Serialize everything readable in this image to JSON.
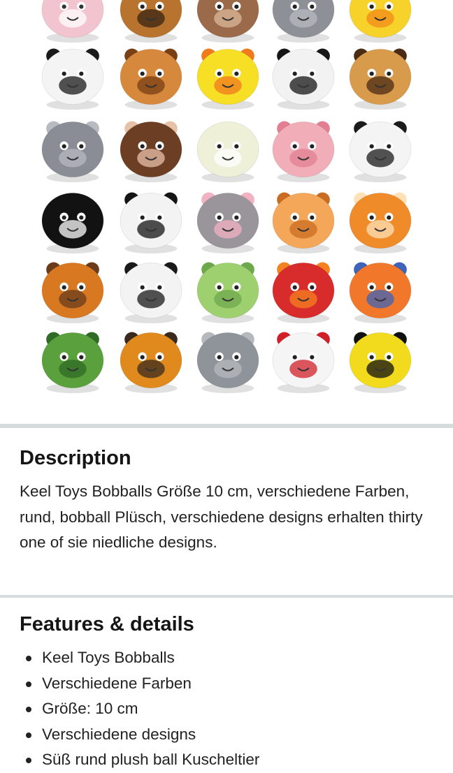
{
  "description": {
    "heading": "Description",
    "text": "Keel Toys Bobballs Größe 10 cm, verschiedene Farben, rund, bobball Plüsch, verschiedene designs erhalten thirty one of sie niedliche designs."
  },
  "features": {
    "heading": "Features & details",
    "items": [
      "Keel Toys Bobballs",
      "Verschiedene Farben",
      "Größe: 10 cm",
      "Verschiedene designs",
      "Süß rund plush ball Kuscheltier"
    ]
  },
  "gallery": {
    "plushies": [
      {
        "name": "pink-bunny",
        "color": "#f2c4cf",
        "accent": "#ffffff",
        "eye": "#333"
      },
      {
        "name": "tiger",
        "color": "#b8742e",
        "accent": "#3a2413",
        "eye": "#222"
      },
      {
        "name": "monkey-brown",
        "color": "#9a6a4a",
        "accent": "#d9b89a",
        "eye": "#222"
      },
      {
        "name": "hippo-grey",
        "color": "#8e9098",
        "accent": "#b7b9c0",
        "eye": "#222"
      },
      {
        "name": "yellow-chick",
        "color": "#f7d22a",
        "accent": "#f28a1b",
        "eye": "#222"
      },
      {
        "name": "cow",
        "color": "#f4f4f4",
        "accent": "#1a1a1a",
        "eye": "#222"
      },
      {
        "name": "giraffe",
        "color": "#d6893d",
        "accent": "#7a3f14",
        "eye": "#222"
      },
      {
        "name": "duck",
        "color": "#f6df25",
        "accent": "#f07a1d",
        "eye": "#222"
      },
      {
        "name": "panda",
        "color": "#f2f2f2",
        "accent": "#161616",
        "eye": "#222"
      },
      {
        "name": "leopard",
        "color": "#d79b4b",
        "accent": "#4b2b14",
        "eye": "#222"
      },
      {
        "name": "elephant",
        "color": "#8a8d95",
        "accent": "#b7bac1",
        "eye": "#222"
      },
      {
        "name": "monkey",
        "color": "#6c3f25",
        "accent": "#e8c2a8",
        "eye": "#222"
      },
      {
        "name": "sheep",
        "color": "#eef0d8",
        "accent": "#ffffff",
        "eye": "#222"
      },
      {
        "name": "pig",
        "color": "#f1aeb9",
        "accent": "#e27f93",
        "eye": "#222"
      },
      {
        "name": "white-tiger",
        "color": "#f4f4f4",
        "accent": "#1b1b1b",
        "eye": "#222"
      },
      {
        "name": "penguin",
        "color": "#121212",
        "accent": "#ffffff",
        "eye": "#222"
      },
      {
        "name": "zebra",
        "color": "#f3f3f3",
        "accent": "#141414",
        "eye": "#222"
      },
      {
        "name": "grey-cat",
        "color": "#9a959b",
        "accent": "#f3b2c3",
        "eye": "#222"
      },
      {
        "name": "orange-tabby",
        "color": "#f4a659",
        "accent": "#c96c22",
        "eye": "#222"
      },
      {
        "name": "lion",
        "color": "#f08b2a",
        "accent": "#fde1b7",
        "eye": "#222"
      },
      {
        "name": "dog",
        "color": "#d87922",
        "accent": "#6a3c1b",
        "eye": "#222"
      },
      {
        "name": "dalmatian",
        "color": "#f3f3f3",
        "accent": "#1a1a1a",
        "eye": "#222"
      },
      {
        "name": "green-turtle",
        "color": "#9fd06f",
        "accent": "#6ea84c",
        "eye": "#222"
      },
      {
        "name": "red-apple",
        "color": "#d82b2b",
        "accent": "#f48220",
        "eye": "#222"
      },
      {
        "name": "orange-fish",
        "color": "#f1782a",
        "accent": "#3f63b8",
        "eye": "#222"
      },
      {
        "name": "frog",
        "color": "#5aa03c",
        "accent": "#2f6a26",
        "eye": "#222"
      },
      {
        "name": "red-panda",
        "color": "#e08a1e",
        "accent": "#3a2a1e",
        "eye": "#222"
      },
      {
        "name": "seal",
        "color": "#8f949b",
        "accent": "#b5b9be",
        "eye": "#222"
      },
      {
        "name": "ladybug",
        "color": "#f5f5f5",
        "accent": "#d11f2a",
        "eye": "#222"
      },
      {
        "name": "bee",
        "color": "#f2db1d",
        "accent": "#111111",
        "eye": "#222"
      }
    ]
  }
}
